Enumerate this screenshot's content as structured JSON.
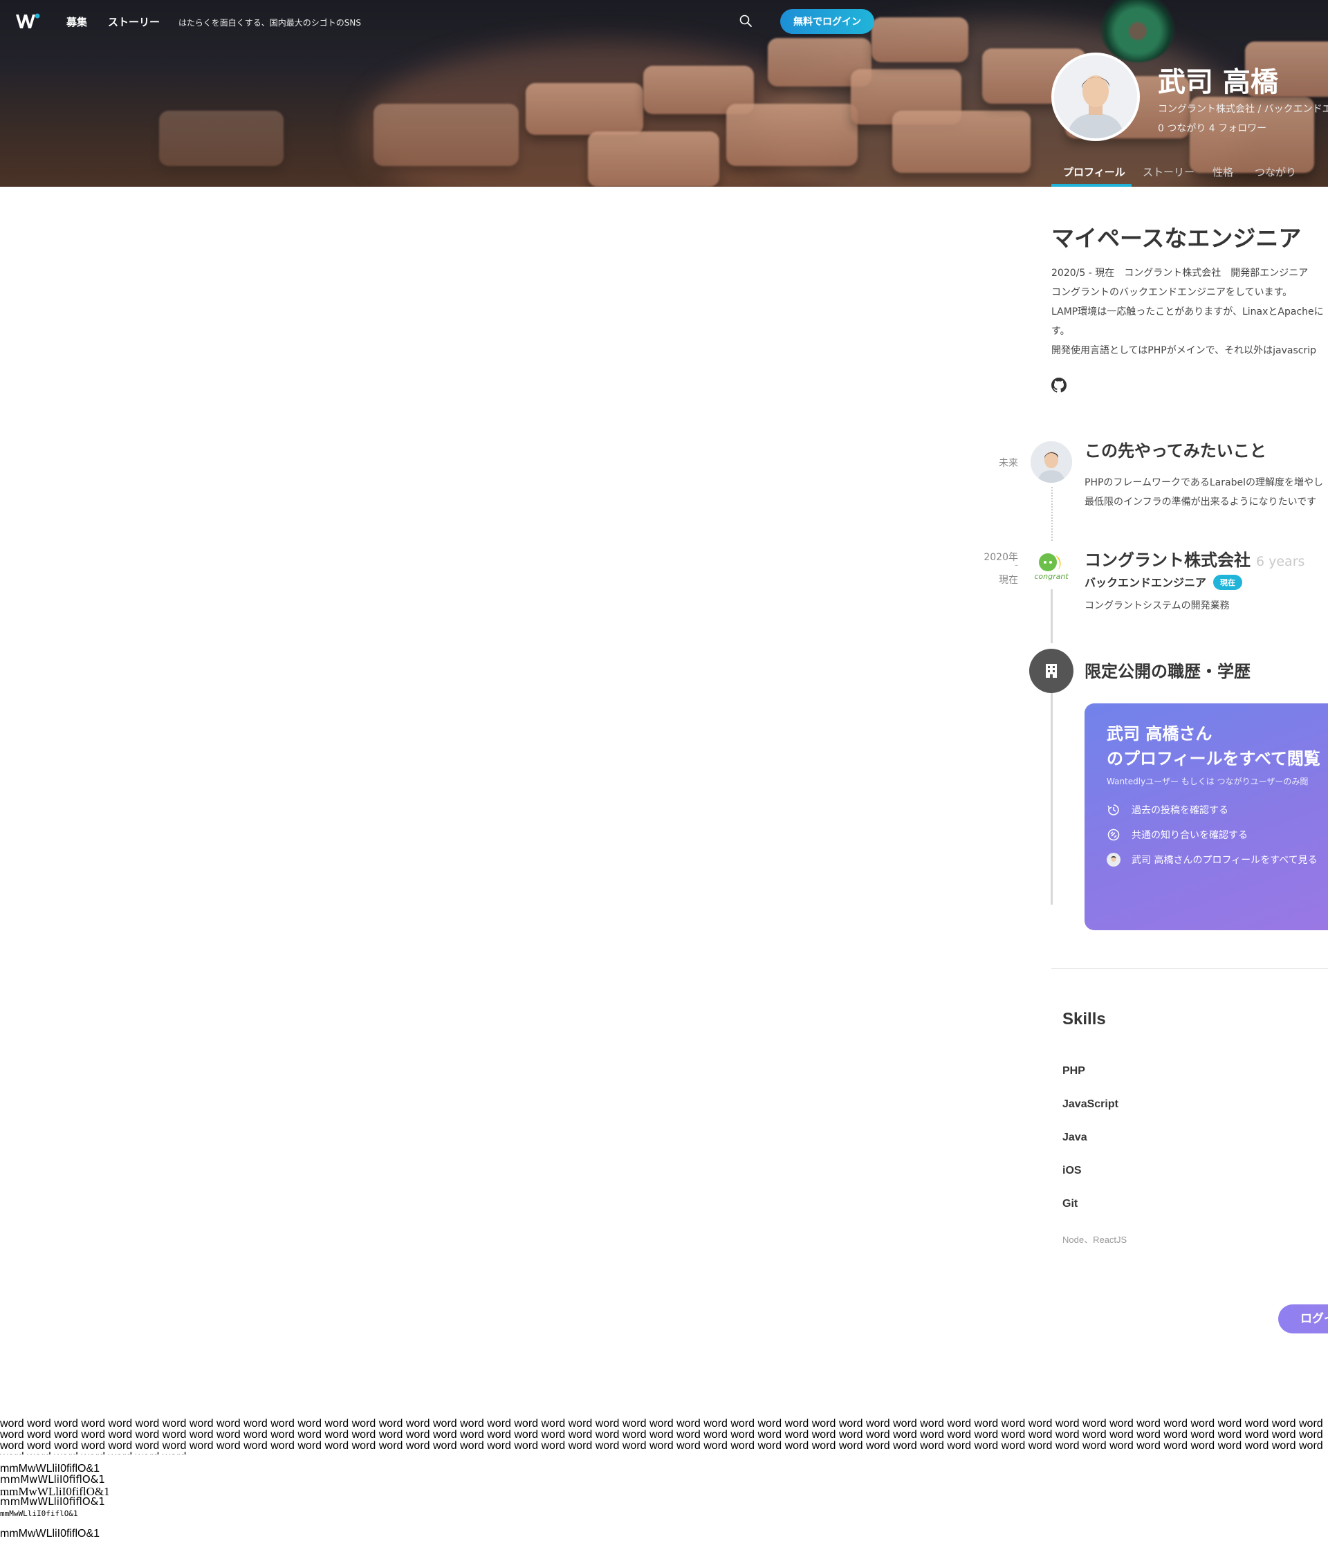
{
  "nav": {
    "links": [
      "募集",
      "ストーリー"
    ],
    "tagline": "はたらくを面白くする、国内最大のシゴトのSNS",
    "login_button": "無料でログイン"
  },
  "profile": {
    "name": "武司 高橋",
    "affiliation": "コングラント株式会社 / バックエンドエ",
    "stats": "0 つながり  4 フォロワー"
  },
  "tabs": [
    "プロフィール",
    "ストーリー",
    "性格",
    "つながり"
  ],
  "headline": "マイペースなエンジニア",
  "description": [
    "2020/5 - 現在　コングラント株式会社　開発部エンジニア",
    "コングラントのバックエンドエンジニアをしています。",
    "LAMP環境は一応触ったことがありますが、LinaxとApacheに",
    "す。",
    "開発使用言語としてはPHPがメインで、それ以外はjavascrip"
  ],
  "timeline": {
    "future": {
      "date": "未来",
      "title": "この先やってみたいこと",
      "lines": [
        "PHPのフレームワークであるLarabelの理解度を増やし",
        "最低限のインフラの準備が出来るようになりたいです"
      ]
    },
    "job": {
      "date_start": "2020年",
      "date_sep": "–",
      "date_end": "現在",
      "company": "コングラント株式会社",
      "years": "6 years",
      "role": "バックエンドエンジニア",
      "badge": "現在",
      "detail": "コングラントシステムの開発業務",
      "logo_text": "congrant"
    },
    "restricted": {
      "title": "限定公開の職歴・学歴"
    }
  },
  "promo": {
    "title_1": "武司 高橋さん",
    "title_2": "のプロフィールをすべて閲覧",
    "subtitle": "Wantedlyユーザー もしくは つながりユーザーのみ閲",
    "items": [
      "過去の投稿を確認する",
      "共通の知り合いを確認する",
      "武司 高橋さんのプロフィールをすべて見る"
    ]
  },
  "skills": {
    "title": "Skills",
    "items": [
      "PHP",
      "JavaScript",
      "Java",
      "iOS",
      "Git"
    ],
    "others": "Node、ReactJS"
  },
  "login_pill": "ログイン",
  "word_dump": "word word word word word word word word word word word word word word word word word word word word word word word word word word word word word word word word word word word word word word word word word word word word word word word word word word word word word word word word word word word word word word word word word word word word word word word word word word word word word word word word word word word word word word word word word word word word word word word word word word word word word word word word word word word word word word word word word word word word word word word word word word word word word word word word word word word word word word word word word word word word word word word word word word word word word word word word word word",
  "font_samples": [
    "mmMwWLliI0fiflO&1",
    "mmMwWLliI0fiflO&1",
    "mmMwWLliI0fiflO&1",
    "mmMwWLliI0fiflO&1",
    "mmMwWLliI0fiflO&1",
    "mmMwWLliI0fiflO&1"
  ]
}
